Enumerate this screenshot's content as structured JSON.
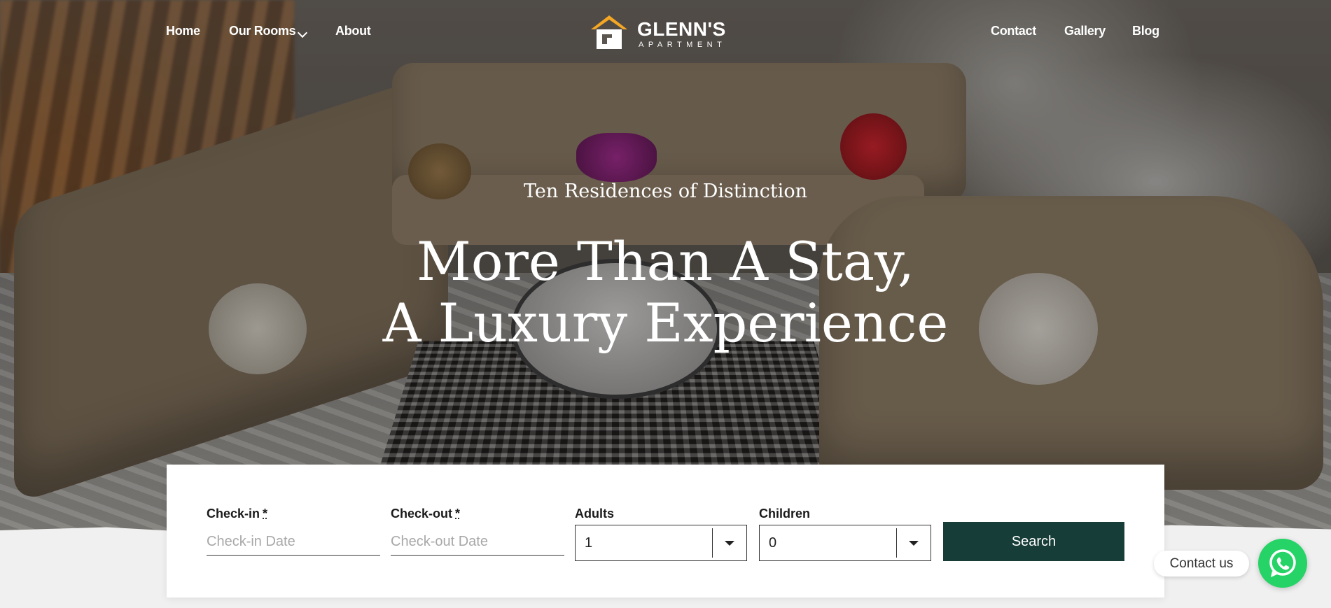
{
  "nav": {
    "left": [
      "Home",
      "Our Rooms",
      "About"
    ],
    "right": [
      "Contact",
      "Gallery",
      "Blog"
    ]
  },
  "logo": {
    "name": "GLENN'S",
    "subtitle": "APARTMENT",
    "brand_color": "#f5a623"
  },
  "hero": {
    "tagline": "Ten Residences of Distinction",
    "headline_line1": "More Than A Stay,",
    "headline_line2": "A Luxury Experience"
  },
  "booking": {
    "checkin_label": "Check-in",
    "checkin_placeholder": "Check-in Date",
    "checkout_label": "Check-out",
    "checkout_placeholder": "Check-out Date",
    "required_mark": "*",
    "adults_label": "Adults",
    "adults_value": "1",
    "children_label": "Children",
    "children_value": "0",
    "search_label": "Search",
    "button_color": "#173d38"
  },
  "whatsapp": {
    "label": "Contact us",
    "color": "#25d366"
  }
}
